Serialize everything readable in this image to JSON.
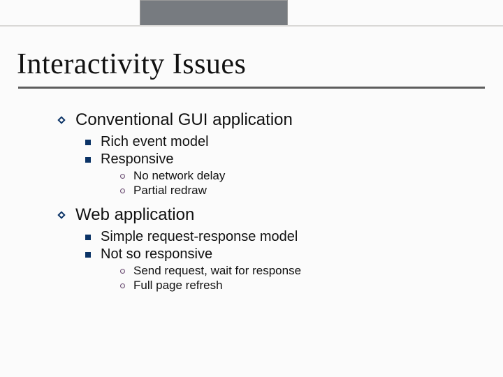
{
  "title": "Interactivity Issues",
  "sections": [
    {
      "heading": "Conventional GUI application",
      "items": [
        {
          "text": "Rich event model",
          "sub": []
        },
        {
          "text": "Responsive",
          "sub": [
            "No network delay",
            "Partial redraw"
          ]
        }
      ]
    },
    {
      "heading": "Web application",
      "items": [
        {
          "text": "Simple request-response model",
          "sub": []
        },
        {
          "text": "Not so responsive",
          "sub": [
            "Send request, wait for response",
            "Full page refresh"
          ]
        }
      ]
    }
  ]
}
